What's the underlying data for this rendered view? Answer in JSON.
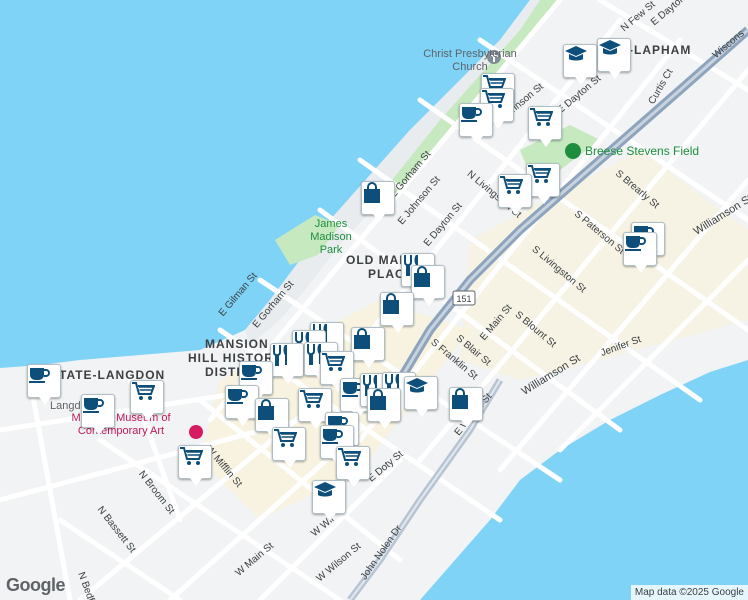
{
  "map": {
    "colors": {
      "water": "#7ed3f7",
      "land": "#f1f3f4",
      "park": "#c7e9c0",
      "road": "#ffffff",
      "highway": "#8ea4bc",
      "pin_icon": "#0d4f7a",
      "commercial": "#fbf2d7"
    },
    "district_labels": [
      {
        "id": "tenney-lapham",
        "text": "TENNEY-LAPHAM"
      },
      {
        "id": "old-market-place-1",
        "text": "OLD MARKET"
      },
      {
        "id": "old-market-place-2",
        "text": "PLACE"
      },
      {
        "id": "mansion-hill-1",
        "text": "MANSION"
      },
      {
        "id": "mansion-hill-2",
        "text": "HILL HISTORIC"
      },
      {
        "id": "mansion-hill-3",
        "text": "DISTRICT"
      },
      {
        "id": "state-langdon",
        "text": "STATE-LANGDON"
      }
    ],
    "poi_labels": [
      {
        "id": "christ-presbyterian",
        "text": "Christ Presbyterian Church"
      },
      {
        "id": "james-madison-park",
        "text": "James Madison Park"
      },
      {
        "id": "breese-stevens",
        "text": "Breese Stevens Field"
      },
      {
        "id": "madison-museum",
        "text": "Madison Museum of Contemporary Art"
      },
      {
        "id": "langdon",
        "text": "Langd"
      }
    ],
    "streets": [
      {
        "id": "n-few",
        "text": "N Few St"
      },
      {
        "id": "e-dayton-top",
        "text": "E Dayton"
      },
      {
        "id": "wisconsin",
        "text": "Wiscons"
      },
      {
        "id": "curtis",
        "text": "Curtis Ct"
      },
      {
        "id": "e-dayton-st",
        "text": "E Dayton St"
      },
      {
        "id": "e-johnson-top",
        "text": "E Johnson St"
      },
      {
        "id": "e-gorham-1",
        "text": "E Gorham St"
      },
      {
        "id": "e-johnson-mid",
        "text": "E Johnson St"
      },
      {
        "id": "e-dayton-mid",
        "text": "E Dayton St"
      },
      {
        "id": "n-livingston",
        "text": "N Livingston St"
      },
      {
        "id": "s-brearly",
        "text": "S Brearly St"
      },
      {
        "id": "s-paterson",
        "text": "S Paterson St"
      },
      {
        "id": "williamson-e",
        "text": "Williamson St"
      },
      {
        "id": "s-livingston",
        "text": "S Livingston St"
      },
      {
        "id": "e-gilman",
        "text": "E Gilman St"
      },
      {
        "id": "e-gorham-2",
        "text": "E Gorham St"
      },
      {
        "id": "e-main",
        "text": "E Main St"
      },
      {
        "id": "s-blount",
        "text": "S Blount St"
      },
      {
        "id": "s-blair",
        "text": "S Blair St"
      },
      {
        "id": "jenifer",
        "text": "Jenifer St"
      },
      {
        "id": "williamson-w",
        "text": "Williamson St"
      },
      {
        "id": "s-franklin",
        "text": "S Franklin St"
      },
      {
        "id": "e-wilson",
        "text": "E Wilson St"
      },
      {
        "id": "n-broom",
        "text": "N Broom St"
      },
      {
        "id": "w-mifflin",
        "text": "W Mifflin St"
      },
      {
        "id": "e-doty",
        "text": "E Doty St"
      },
      {
        "id": "n-bassett",
        "text": "N Bassett St"
      },
      {
        "id": "w-wilson-1",
        "text": "W Wil"
      },
      {
        "id": "w-main",
        "text": "W Main St"
      },
      {
        "id": "w-wilson-2",
        "text": "W Wilson St"
      },
      {
        "id": "john-nolen",
        "text": "John Nolen Dr"
      },
      {
        "id": "n-bedford",
        "text": "N Bedf"
      },
      {
        "id": "route-151",
        "text": "151"
      }
    ],
    "attribution": "Map data ©2025 Google",
    "logo": "Google"
  }
}
